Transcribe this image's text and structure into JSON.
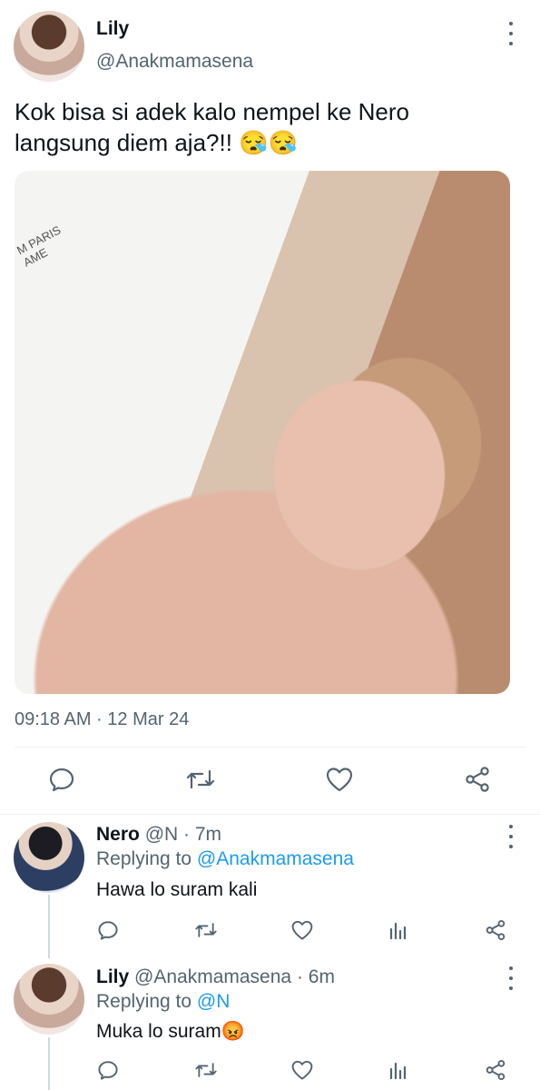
{
  "tweet": {
    "author_name": "Lily",
    "author_handle": "@Anakmamasena",
    "text_line1": "Kok bisa si adek kalo nempel ke Nero",
    "text_line2": "langsung diem aja?!!",
    "emoji": "😪😪",
    "photo_text_line1": "M PARIS",
    "photo_text_line2": "AME",
    "timestamp": "09:18 AM · 12 Mar 24",
    "actions": [
      "reply-icon",
      "retweet-icon",
      "like-icon",
      "share-icon"
    ]
  },
  "replies": [
    {
      "name": "Nero",
      "handle": "@N",
      "sep": "·",
      "time": "7m",
      "replying_label": "Replying to",
      "replying_to": "@Anakmamasena",
      "text": "Hawa lo suram kali",
      "emoji": ""
    },
    {
      "name": "Lily",
      "handle": "@Anakmamasena",
      "sep": "·",
      "time": "6m",
      "replying_label": "Replying to",
      "replying_to": "@N",
      "text": "Muka lo suram",
      "emoji": "😡"
    }
  ],
  "colors": {
    "accent": "#1d9bf0",
    "secondary_text": "#536471",
    "icon": "#536471"
  }
}
